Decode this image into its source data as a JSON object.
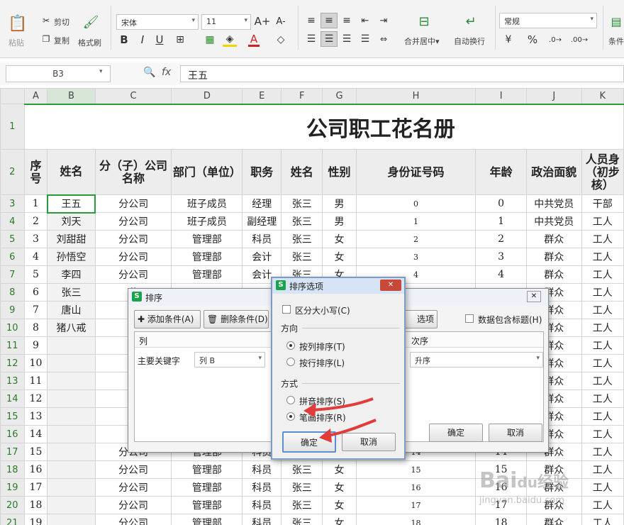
{
  "ribbon": {
    "paste": "粘贴",
    "cut": "剪切",
    "copy": "复制",
    "format_painter": "格式刷",
    "font_name": "宋体",
    "font_size": "11",
    "bold": "B",
    "italic": "I",
    "underline": "U",
    "font_color_glyph": "A",
    "grow_font": "A+",
    "shrink_font": "A-",
    "merge_center": "合并居中",
    "merge_caret": "▾",
    "wrap_text": "自动换行",
    "number_format": "常规",
    "percent": "%",
    "currency": "¥",
    "cond_format": "条件"
  },
  "formula_bar": {
    "cell_ref": "B3",
    "fx": "fx",
    "value": "王五"
  },
  "sheet": {
    "columns": [
      "A",
      "B",
      "C",
      "D",
      "E",
      "F",
      "G",
      "H",
      "I",
      "J",
      "K"
    ],
    "title": "公司职工花名册",
    "headers": [
      "序号",
      "姓名",
      "分（子）公司名称",
      "部门（单位）",
      "职务",
      "姓名",
      "性别",
      "身份证号码",
      "年龄",
      "政治面貌",
      "人员身（初步核）"
    ],
    "rows": [
      {
        "n": "3",
        "c": [
          "1",
          "王五",
          "分公司",
          "班子成员",
          "经理",
          "张三",
          "男",
          "0",
          "0",
          "中共党员",
          "干部"
        ]
      },
      {
        "n": "4",
        "c": [
          "2",
          "刘天",
          "分公司",
          "班子成员",
          "副经理",
          "张三",
          "男",
          "1",
          "1",
          "中共党员",
          "工人"
        ]
      },
      {
        "n": "5",
        "c": [
          "3",
          "刘甜甜",
          "分公司",
          "管理部",
          "科员",
          "张三",
          "女",
          "2",
          "2",
          "群众",
          "工人"
        ]
      },
      {
        "n": "6",
        "c": [
          "4",
          "孙悟空",
          "分公司",
          "管理部",
          "会计",
          "张三",
          "女",
          "3",
          "3",
          "群众",
          "工人"
        ]
      },
      {
        "n": "7",
        "c": [
          "5",
          "李四",
          "分公司",
          "管理部",
          "会计",
          "张三",
          "女",
          "4",
          "4",
          "群众",
          "工人"
        ]
      },
      {
        "n": "8",
        "c": [
          "6",
          "张三",
          "分",
          "",
          "",
          "",
          "",
          "",
          "",
          "群众",
          "工人"
        ]
      },
      {
        "n": "9",
        "c": [
          "7",
          "唐山",
          "分",
          "",
          "",
          "",
          "",
          "",
          "",
          "群众",
          "工人"
        ]
      },
      {
        "n": "10",
        "c": [
          "8",
          "猪八戒",
          "分",
          "",
          "",
          "",
          "",
          "",
          "",
          "群众",
          "工人"
        ]
      },
      {
        "n": "11",
        "c": [
          "9",
          "",
          "分",
          "",
          "",
          "",
          "",
          "",
          "",
          "群众",
          "工人"
        ]
      },
      {
        "n": "12",
        "c": [
          "10",
          "",
          "分",
          "",
          "",
          "",
          "",
          "",
          "",
          "群众",
          "工人"
        ]
      },
      {
        "n": "13",
        "c": [
          "11",
          "",
          "分",
          "",
          "",
          "",
          "",
          "",
          "",
          "群众",
          "工人"
        ]
      },
      {
        "n": "14",
        "c": [
          "12",
          "",
          "分",
          "",
          "",
          "",
          "",
          "",
          "",
          "群众",
          "工人"
        ]
      },
      {
        "n": "15",
        "c": [
          "13",
          "",
          "分",
          "",
          "",
          "",
          "",
          "",
          "",
          "群众",
          "工人"
        ]
      },
      {
        "n": "16",
        "c": [
          "14",
          "",
          "分",
          "",
          "",
          "",
          "",
          "",
          "",
          "群众",
          "工人"
        ]
      },
      {
        "n": "17",
        "c": [
          "15",
          "",
          "分公司",
          "管理部",
          "科员",
          "",
          "",
          "14",
          "14",
          "群众",
          "工人"
        ]
      },
      {
        "n": "18",
        "c": [
          "16",
          "",
          "分公司",
          "管理部",
          "科员",
          "张三",
          "女",
          "15",
          "15",
          "群众",
          "工人"
        ]
      },
      {
        "n": "19",
        "c": [
          "17",
          "",
          "分公司",
          "管理部",
          "科员",
          "张三",
          "女",
          "16",
          "16",
          "群众",
          "工人"
        ]
      },
      {
        "n": "20",
        "c": [
          "18",
          "",
          "分公司",
          "管理部",
          "科员",
          "张三",
          "女",
          "17",
          "17",
          "群众",
          "工人"
        ]
      },
      {
        "n": "21",
        "c": [
          "19",
          "",
          "分公司",
          "管理部",
          "科员",
          "张三",
          "女",
          "18",
          "18",
          "群众",
          "工人"
        ]
      }
    ]
  },
  "sort_dialog": {
    "title": "排序",
    "close": "✕",
    "add_condition": "添加条件(A)",
    "delete_condition": "删除条件(D)",
    "options_btn": "选项(O)...",
    "has_header": "数据包含标题(H)",
    "col_header": "列",
    "order_header": "次序",
    "primary_key": "主要关键字",
    "column_value": "列 B",
    "order_value": "升序",
    "ok": "确定",
    "cancel": "取消"
  },
  "options_dialog": {
    "title": "排序选项",
    "close": "✕",
    "case_sensitive": "区分大小写(C)",
    "direction_label": "方向",
    "by_column": "按列排序(T)",
    "by_row": "按行排序(L)",
    "method_label": "方式",
    "pinyin": "拼音排序(S)",
    "stroke": "笔画排序(R)",
    "ok": "确定",
    "cancel": "取消"
  },
  "watermark": {
    "brand": "Bai",
    "brand_icon": "du",
    "suffix": "经验",
    "url": "jingyan.baidu.com"
  },
  "colors": {
    "accent_green": "#2a9a3a",
    "dialog_title": "#d6e4f5",
    "arrow_red": "#e23b3b"
  }
}
